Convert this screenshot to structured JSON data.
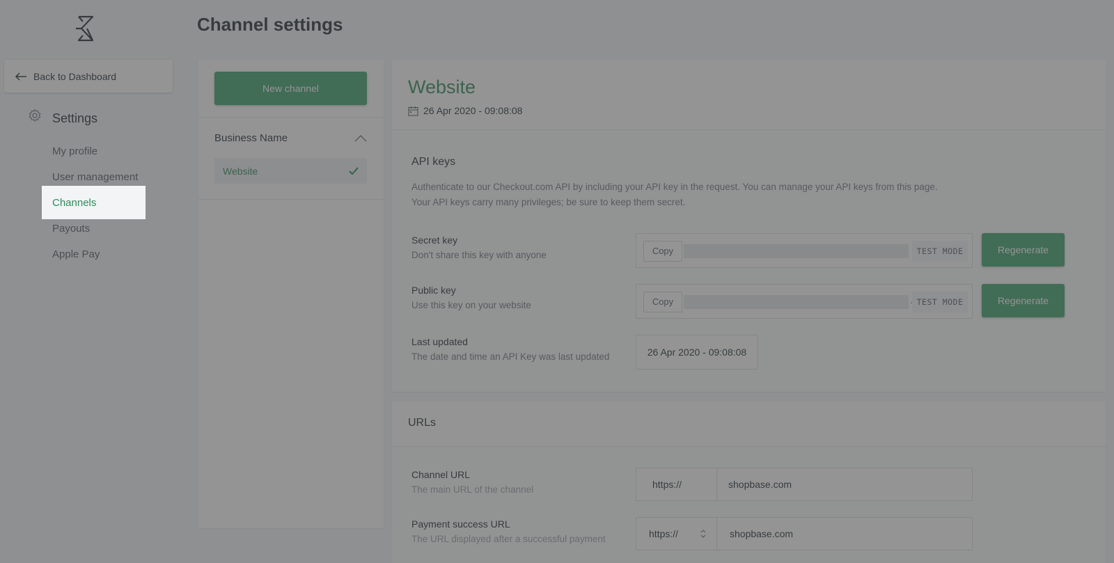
{
  "page": {
    "title": "Channel settings"
  },
  "sidebar": {
    "back_label": "Back to Dashboard",
    "section_label": "Settings",
    "items": [
      {
        "label": "My profile"
      },
      {
        "label": "User management"
      },
      {
        "label": "Channels",
        "active": true
      },
      {
        "label": "Payouts"
      },
      {
        "label": "Apple Pay"
      }
    ]
  },
  "channels": {
    "new_button": "New channel",
    "business_name": "Business Name",
    "selected_channel": "Website"
  },
  "website": {
    "title": "Website",
    "created": "26 Apr 2020 - 09:08:08"
  },
  "api_keys": {
    "heading": "API keys",
    "description_line1": "Authenticate to our Checkout.com API by including your API key in the request. You can manage your API keys from this page.",
    "description_line2": "Your API keys carry many privileges; be sure to keep them secret.",
    "secret_key": {
      "title": "Secret key",
      "subtitle": "Don't share this key with anyone",
      "copy": "Copy",
      "mode": "TEST MODE",
      "regenerate": "Regenerate"
    },
    "public_key": {
      "title": "Public key",
      "subtitle": "Use this key on your website",
      "copy": "Copy",
      "dot": ".",
      "mode": "TEST MODE",
      "regenerate": "Regenerate"
    },
    "last_updated": {
      "title": "Last updated",
      "subtitle": "The date and time an API Key was last updated",
      "value": "26 Apr 2020 - 09:08:08"
    }
  },
  "urls": {
    "heading": "URLs",
    "channel_url": {
      "title": "Channel URL",
      "subtitle": "The main URL of the channel",
      "protocol": "https://",
      "domain": "shopbase.com"
    },
    "payment_success_url": {
      "title": "Payment success URL",
      "subtitle": "The URL displayed after a successful payment",
      "protocol": "https://",
      "domain": "shopbase.com"
    }
  },
  "colors": {
    "brand_green": "#3a9f6c",
    "active_text": "#2f8a5c",
    "overlay": "rgba(70,70,70,0.58)"
  },
  "icons": [
    "logo-icon",
    "back-arrow-icon",
    "gear-icon",
    "chevron-up-icon",
    "checkmark-icon",
    "calendar-icon",
    "select-arrows-icon"
  ]
}
